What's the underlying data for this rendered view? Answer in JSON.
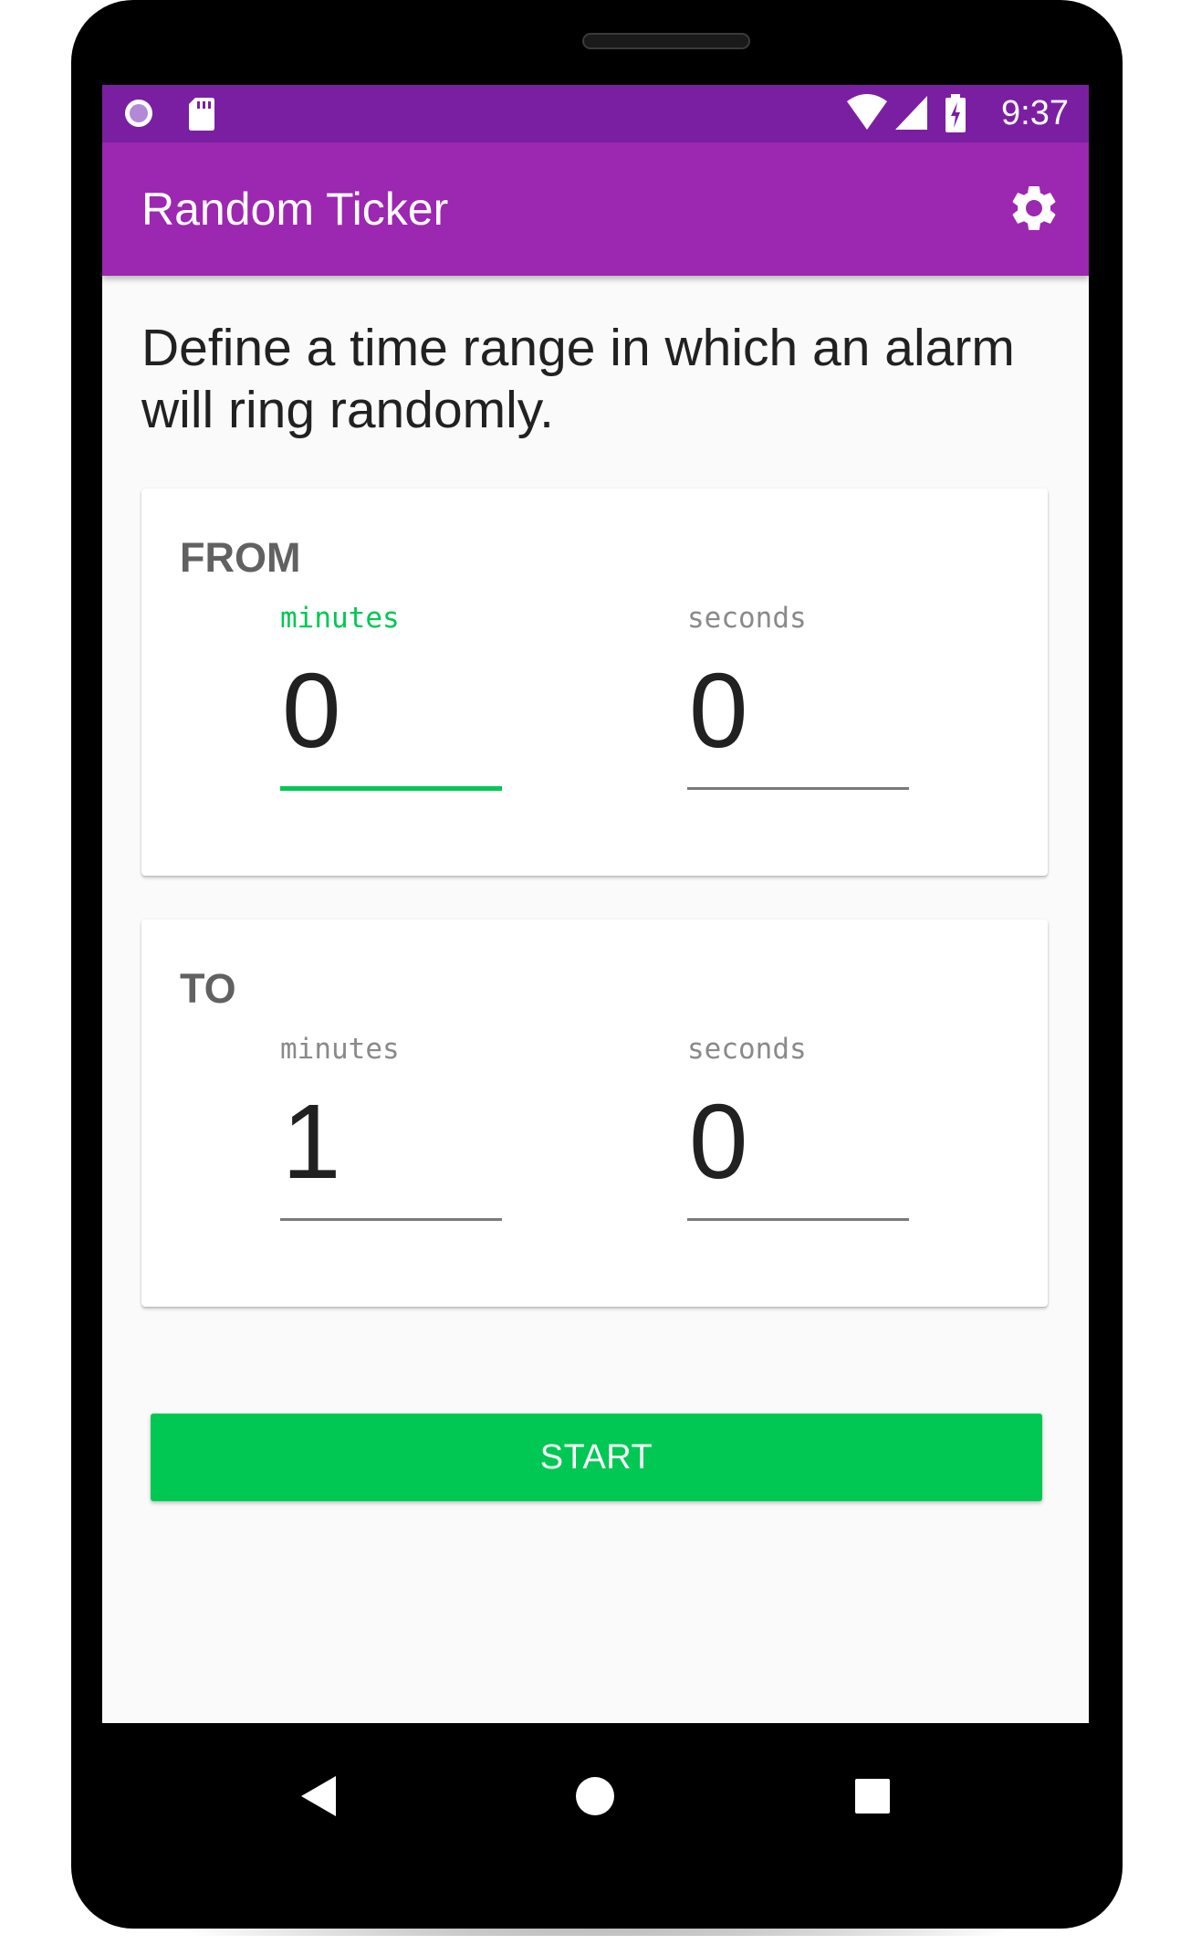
{
  "status_bar": {
    "time": "9:37",
    "icons": [
      "notification-dot-icon",
      "sd-card-icon",
      "wifi-icon",
      "cell-signal-icon",
      "battery-charging-icon"
    ]
  },
  "app_bar": {
    "title": "Random Ticker",
    "settings_icon": "gear-icon"
  },
  "intro_text": "Define a time range in which an alarm will ring randomly.",
  "from_card": {
    "title": "FROM",
    "minutes": {
      "label": "minutes",
      "value": "0",
      "focused": true
    },
    "seconds": {
      "label": "seconds",
      "value": "0",
      "focused": false
    }
  },
  "to_card": {
    "title": "TO",
    "minutes": {
      "label": "minutes",
      "value": "1",
      "focused": false
    },
    "seconds": {
      "label": "seconds",
      "value": "0",
      "focused": false
    }
  },
  "start_button": {
    "label": "START"
  },
  "nav_bar": {
    "icons": [
      "back-icon",
      "home-icon",
      "recents-icon"
    ]
  },
  "colors": {
    "status_bar": "#7b1fa2",
    "app_bar": "#9c27b0",
    "accent": "#00c853",
    "background": "#fafafa"
  }
}
